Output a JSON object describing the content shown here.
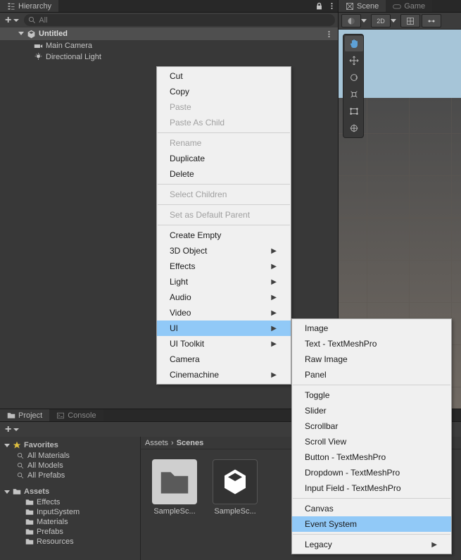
{
  "hierarchy": {
    "tab": "Hierarchy",
    "search_placeholder": "All",
    "scene": "Untitled",
    "items": [
      "Main Camera",
      "Directional Light"
    ]
  },
  "scene": {
    "tabs": [
      "Scene",
      "Game"
    ]
  },
  "project": {
    "tabs": [
      "Project",
      "Console"
    ],
    "favorites_label": "Favorites",
    "favorites": [
      "All Materials",
      "All Models",
      "All Prefabs"
    ],
    "assets_label": "Assets",
    "assets": [
      "Effects",
      "InputSystem",
      "Materials",
      "Prefabs",
      "Resources"
    ],
    "breadcrumb": [
      "Assets",
      "Scenes"
    ],
    "grid_items": [
      "SampleSc...",
      "SampleSc..."
    ]
  },
  "context_menu": {
    "items": [
      {
        "label": "Cut"
      },
      {
        "label": "Copy"
      },
      {
        "label": "Paste",
        "disabled": true
      },
      {
        "label": "Paste As Child",
        "disabled": true
      },
      {
        "sep": true
      },
      {
        "label": "Rename",
        "disabled": true
      },
      {
        "label": "Duplicate"
      },
      {
        "label": "Delete"
      },
      {
        "sep": true
      },
      {
        "label": "Select Children",
        "disabled": true
      },
      {
        "sep": true
      },
      {
        "label": "Set as Default Parent",
        "disabled": true
      },
      {
        "sep": true
      },
      {
        "label": "Create Empty"
      },
      {
        "label": "3D Object",
        "sub": true
      },
      {
        "label": "Effects",
        "sub": true
      },
      {
        "label": "Light",
        "sub": true
      },
      {
        "label": "Audio",
        "sub": true
      },
      {
        "label": "Video",
        "sub": true
      },
      {
        "label": "UI",
        "sub": true,
        "hl": true
      },
      {
        "label": "UI Toolkit",
        "sub": true
      },
      {
        "label": "Camera"
      },
      {
        "label": "Cinemachine",
        "sub": true
      }
    ],
    "submenu": [
      {
        "label": "Image"
      },
      {
        "label": "Text - TextMeshPro"
      },
      {
        "label": "Raw Image"
      },
      {
        "label": "Panel"
      },
      {
        "sep": true
      },
      {
        "label": "Toggle"
      },
      {
        "label": "Slider"
      },
      {
        "label": "Scrollbar"
      },
      {
        "label": "Scroll View"
      },
      {
        "label": "Button - TextMeshPro"
      },
      {
        "label": "Dropdown - TextMeshPro"
      },
      {
        "label": "Input Field - TextMeshPro"
      },
      {
        "sep": true
      },
      {
        "label": "Canvas"
      },
      {
        "label": "Event System",
        "hl": true
      },
      {
        "sep": true
      },
      {
        "label": "Legacy",
        "sub": true
      }
    ]
  }
}
